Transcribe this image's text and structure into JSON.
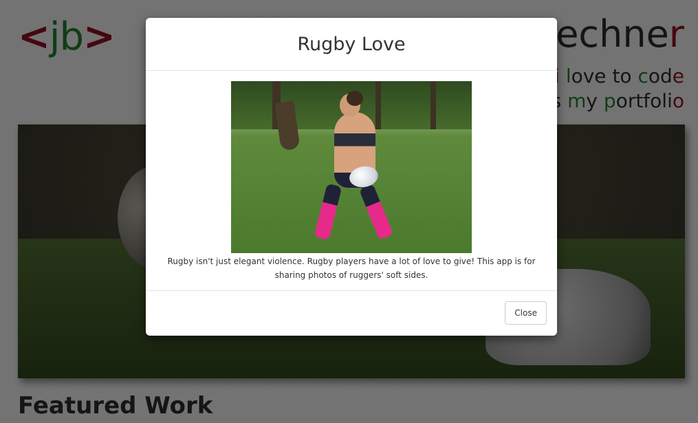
{
  "background_page": {
    "logo": {
      "open": "<",
      "initials": "jb",
      "close": ">"
    },
    "site_name": {
      "visible": "uechne",
      "last_letter": "r"
    },
    "tagline": {
      "line1": [
        {
          "text": "i",
          "color": "red"
        },
        {
          "text": " "
        },
        {
          "text": "l",
          "color": "green"
        },
        {
          "text": "ove to "
        },
        {
          "text": "c",
          "color": "green"
        },
        {
          "text": "od"
        },
        {
          "text": "e",
          "color": "red"
        }
      ],
      "line2": [
        {
          "text": "is "
        },
        {
          "text": "m",
          "color": "green"
        },
        {
          "text": "y "
        },
        {
          "text": "p",
          "color": "green"
        },
        {
          "text": "ortfoli"
        },
        {
          "text": "o",
          "color": "red"
        }
      ]
    },
    "section_heading": "Featured Work"
  },
  "modal": {
    "title": "Rugby Love",
    "image_alt": "Pregnant rugby player holding a rugby ball on a grass field",
    "caption": "Rugby isn't just elegant violence. Rugby players have a lot of love to give! This app is for sharing photos of ruggers' soft sides.",
    "close_label": "Close"
  },
  "colors": {
    "accent_red": "#8a1020",
    "accent_green": "#1f7a2c",
    "text": "#333333",
    "backdrop": "rgba(0,0,0,0.5)"
  }
}
